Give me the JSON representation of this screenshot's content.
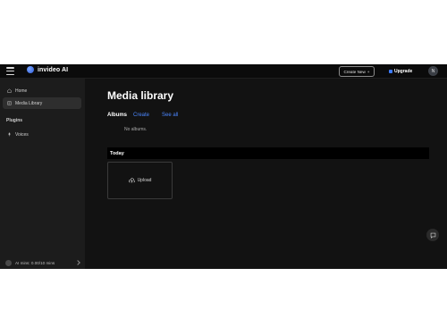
{
  "topbar": {
    "brand_name": "invideo AI",
    "create_new_label": "Create New",
    "create_new_icon": "plus-icon",
    "upgrade_label": "Upgrade",
    "avatar_initial": "N"
  },
  "sidebar": {
    "items": [
      {
        "label": "Home",
        "icon": "home-icon",
        "active": false
      },
      {
        "label": "Media Library",
        "icon": "media-library-icon",
        "active": true
      }
    ],
    "plugins_label": "Plugins",
    "plugin_items": [
      {
        "label": "Voices",
        "icon": "microphone-icon"
      }
    ],
    "usage_text": "AI mins: 0.00/10 mins"
  },
  "main": {
    "title": "Media library",
    "albums_label": "Albums",
    "create_link": "Create",
    "see_all_link": "See all",
    "no_albums_text": "No albums.",
    "today_label": "Today",
    "upload_label": "Upload"
  },
  "colors": {
    "accent": "#4b87ff",
    "background": "#121212",
    "sidebar": "#1c1c1c"
  }
}
